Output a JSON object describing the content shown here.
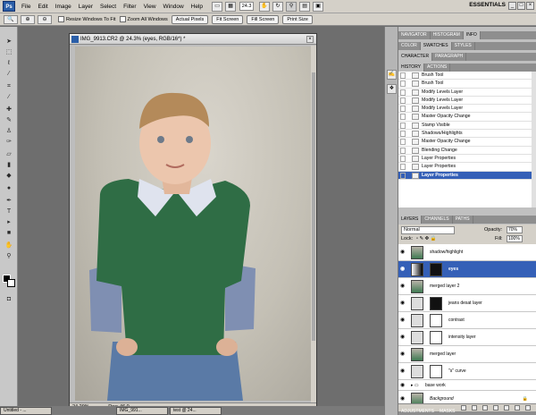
{
  "app": {
    "logo": "Ps",
    "workspace": "ESSENTIALS",
    "zoom": "24.3",
    "win_controls": [
      "_",
      "□",
      "×"
    ]
  },
  "menu": [
    "File",
    "Edit",
    "Image",
    "Layer",
    "Select",
    "Filter",
    "View",
    "Window",
    "Help"
  ],
  "options": {
    "tool_symbol": "🔍",
    "resize_windows": "Resize Windows To Fit",
    "zoom_all": "Zoom All Windows",
    "buttons": [
      "Actual Pixels",
      "Fit Screen",
      "Fill Screen",
      "Print Size"
    ]
  },
  "document": {
    "title": "IMG_9913.CR2 @ 24.3% (eyes, RGB/16*) *",
    "zoom": "24.29%",
    "doc_info": "Doc: 46.0",
    "close": "×"
  },
  "panels": {
    "top_tabs": [
      "NAVIGATOR",
      "HISTOGRAM",
      "INFO"
    ],
    "color_tabs": [
      "COLOR",
      "SWATCHES",
      "STYLES"
    ],
    "char_tabs": [
      "CHARACTER",
      "PARAGRAPH"
    ],
    "history_tabs": [
      "HISTORY",
      "ACTIONS"
    ],
    "history": [
      "Brush Tool",
      "Brush Tool",
      "Modify Levels Layer",
      "Modify Levels Layer",
      "Modify Levels Layer",
      "Master Opacity Change",
      "Stamp Visible",
      "Shadows/Highlights",
      "Master Opacity Change",
      "Blending Change",
      "Layer Properties",
      "Layer Properties",
      "Layer Properties"
    ],
    "layers_tabs": [
      "LAYERS",
      "CHANNELS",
      "PATHS"
    ],
    "blend_mode": "Normal",
    "opacity_label": "Opacity:",
    "opacity": "70%",
    "lock_label": "Lock:",
    "fill_label": "Fill:",
    "fill": "100%",
    "layers": [
      {
        "name": "shadow/highlight",
        "mask": "none"
      },
      {
        "name": "eyes",
        "mask": "dark",
        "selected": true
      },
      {
        "name": "merged layer 2",
        "mask": "none"
      },
      {
        "name": "jeans desat layer",
        "mask": "dark"
      },
      {
        "name": "contrast",
        "mask": "white"
      },
      {
        "name": "intensity layer",
        "mask": "white"
      },
      {
        "name": "merged layer",
        "mask": "none"
      },
      {
        "name": "\"s\" curve",
        "mask": "white"
      },
      {
        "name": "base work",
        "group": true
      },
      {
        "name": "Background",
        "mask": "none"
      }
    ],
    "bottom_tabs": [
      "ADJUSTMENTS",
      "MASKS"
    ]
  },
  "taskbar": [
    "Untitled - ...",
    "IMG_991...",
    "test @ 24..."
  ],
  "icons": {
    "tools": [
      "move-icon",
      "marquee-icon",
      "lasso-icon",
      "magic-wand-icon",
      "crop-icon",
      "eyedropper-icon",
      "healing-brush-icon",
      "brush-icon",
      "clone-stamp-icon",
      "history-brush-icon",
      "eraser-icon",
      "gradient-icon",
      "blur-icon",
      "dodge-icon",
      "pen-icon",
      "type-icon",
      "path-select-icon",
      "shape-icon",
      "hand-icon",
      "zoom-icon"
    ]
  }
}
